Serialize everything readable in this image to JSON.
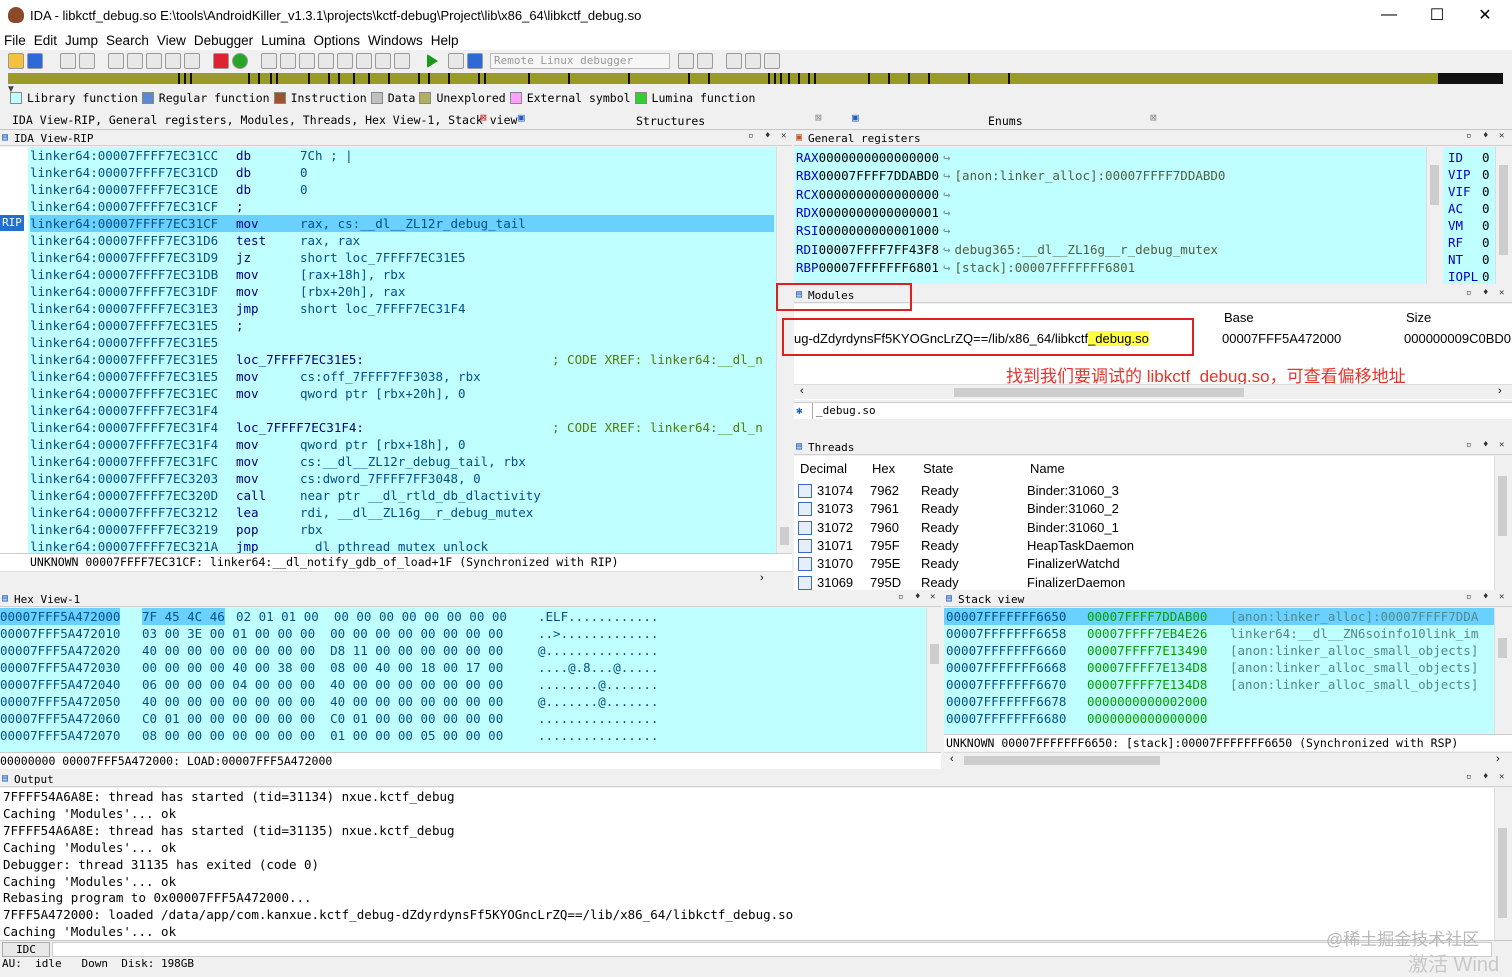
{
  "window": {
    "title": "IDA - libkctf_debug.so E:\\tools\\AndroidKiller_v1.3.1\\projects\\kctf-debug\\Project\\lib\\x86_64\\libkctf_debug.so",
    "minimize": "—",
    "maximize": "☐",
    "close": "✕"
  },
  "menu": [
    "File",
    "Edit",
    "Jump",
    "Search",
    "View",
    "Debugger",
    "Lumina",
    "Options",
    "Windows",
    "Help"
  ],
  "toolbar": {
    "debugger_select": "Remote Linux debugger"
  },
  "legend": [
    {
      "label": "Library function",
      "color": "#c0ffff"
    },
    {
      "label": "Regular function",
      "color": "#5a8ad0"
    },
    {
      "label": "Instruction",
      "color": "#a0522d"
    },
    {
      "label": "Data",
      "color": "#c0c0c0"
    },
    {
      "label": "Unexplored",
      "color": "#b0b060"
    },
    {
      "label": "External symbol",
      "color": "#ffa0ff"
    },
    {
      "label": "Lumina function",
      "color": "#30d030"
    }
  ],
  "tabs": {
    "left": "IDA View-RIP, General registers, Modules, Threads, Hex View-1, Stack view",
    "structures": "Structures",
    "enums": "Enums"
  },
  "ida_view": {
    "title": "IDA View-RIP",
    "rip_label": "RIP",
    "lines": [
      {
        "addr": "linker64:00007FFFF7EC31CC",
        "mn": "db",
        "op": "7Ch ; |",
        "cm": ""
      },
      {
        "addr": "linker64:00007FFFF7EC31CD",
        "mn": "db",
        "op": "0",
        "cm": ""
      },
      {
        "addr": "linker64:00007FFFF7EC31CE",
        "mn": "db",
        "op": "0",
        "cm": ""
      },
      {
        "addr": "linker64:00007FFFF7EC31CF",
        "mn": ";",
        "op": "",
        "cm": ""
      },
      {
        "addr": "linker64:00007FFFF7EC31CF",
        "mn": "mov",
        "op": "rax, cs:__dl__ZL12r_debug_tail",
        "cm": ""
      },
      {
        "addr": "linker64:00007FFFF7EC31D6",
        "mn": "test",
        "op": "rax, rax",
        "cm": ""
      },
      {
        "addr": "linker64:00007FFFF7EC31D9",
        "mn": "jz",
        "op": "short loc_7FFFF7EC31E5",
        "cm": ""
      },
      {
        "addr": "linker64:00007FFFF7EC31DB",
        "mn": "mov",
        "op": "[rax+18h], rbx",
        "cm": ""
      },
      {
        "addr": "linker64:00007FFFF7EC31DF",
        "mn": "mov",
        "op": "[rbx+20h], rax",
        "cm": ""
      },
      {
        "addr": "linker64:00007FFFF7EC31E3",
        "mn": "jmp",
        "op": "short loc_7FFFF7EC31F4",
        "cm": ""
      },
      {
        "addr": "linker64:00007FFFF7EC31E5",
        "mn": ";",
        "op": "",
        "cm": ""
      },
      {
        "addr": "linker64:00007FFFF7EC31E5",
        "mn": "",
        "op": "",
        "cm": ""
      },
      {
        "addr": "linker64:00007FFFF7EC31E5",
        "mn": "loc_7FFFF7EC31E5:",
        "op": "",
        "cm": "; CODE XREF: linker64:__dl_n"
      },
      {
        "addr": "linker64:00007FFFF7EC31E5",
        "mn": "mov",
        "op": "cs:off_7FFFF7FF3038, rbx",
        "cm": ""
      },
      {
        "addr": "linker64:00007FFFF7EC31EC",
        "mn": "mov",
        "op": "qword ptr [rbx+20h], 0",
        "cm": ""
      },
      {
        "addr": "linker64:00007FFFF7EC31F4",
        "mn": "",
        "op": "",
        "cm": ""
      },
      {
        "addr": "linker64:00007FFFF7EC31F4",
        "mn": "loc_7FFFF7EC31F4:",
        "op": "",
        "cm": "; CODE XREF: linker64:__dl_n"
      },
      {
        "addr": "linker64:00007FFFF7EC31F4",
        "mn": "mov",
        "op": "qword ptr [rbx+18h], 0",
        "cm": ""
      },
      {
        "addr": "linker64:00007FFFF7EC31FC",
        "mn": "mov",
        "op": "cs:__dl__ZL12r_debug_tail, rbx",
        "cm": ""
      },
      {
        "addr": "linker64:00007FFFF7EC3203",
        "mn": "mov",
        "op": "cs:dword_7FFFF7FF3048, 0",
        "cm": ""
      },
      {
        "addr": "linker64:00007FFFF7EC320D",
        "mn": "call",
        "op": "near ptr __dl_rtld_db_dlactivity",
        "cm": ""
      },
      {
        "addr": "linker64:00007FFFF7EC3212",
        "mn": "lea",
        "op": "rdi, __dl__ZL16g__r_debug_mutex",
        "cm": ""
      },
      {
        "addr": "linker64:00007FFFF7EC3219",
        "mn": "pop",
        "op": "rbx",
        "cm": ""
      },
      {
        "addr": "linker64:00007FFFF7EC321A",
        "mn": "jmp",
        "op": "__dl_pthread_mutex_unlock",
        "cm": ""
      }
    ],
    "status": "UNKNOWN 00007FFFF7EC31CF: linker64:__dl_notify_gdb_of_load+1F (Synchronized with RIP)"
  },
  "general_registers": {
    "title": "General registers",
    "regs": [
      {
        "name": "RAX",
        "value": "0000000000000000",
        "target": ""
      },
      {
        "name": "RBX",
        "value": "00007FFFF7DDABD0",
        "target": "[anon:linker_alloc]:00007FFFF7DDABD0"
      },
      {
        "name": "RCX",
        "value": "0000000000000000",
        "target": ""
      },
      {
        "name": "RDX",
        "value": "0000000000000001",
        "target": ""
      },
      {
        "name": "RSI",
        "value": "0000000000001000",
        "target": ""
      },
      {
        "name": "RDI",
        "value": "00007FFFF7FF43F8",
        "target": "debug365:__dl__ZL16g__r_debug_mutex"
      },
      {
        "name": "RBP",
        "value": "00007FFFFFFF6801",
        "target": "[stack]:00007FFFFFFF6801"
      }
    ],
    "flags": [
      {
        "name": "ID",
        "value": "0"
      },
      {
        "name": "VIP",
        "value": "0"
      },
      {
        "name": "VIF",
        "value": "0"
      },
      {
        "name": "AC",
        "value": "0"
      },
      {
        "name": "VM",
        "value": "0"
      },
      {
        "name": "RF",
        "value": "0"
      },
      {
        "name": "NT",
        "value": "0"
      },
      {
        "name": "IOPL",
        "value": "0"
      }
    ]
  },
  "modules": {
    "title": "Modules",
    "col_base": "Base",
    "col_size": "Size",
    "row_path_a": "ug-dZdyrdynsFf5KYOGncLrZQ==/lib/x86_64/libkctf",
    "row_path_b": "_debug.so",
    "row_base": "00007FFF5A472000",
    "row_size": "000000009C0BD0",
    "annotation": "找到我们要调试的 libkctf_debug.so，可查看偏移地址",
    "filter": "_debug.so"
  },
  "threads": {
    "title": "Threads",
    "columns": [
      "Decimal",
      "Hex",
      "State",
      "Name"
    ],
    "rows": [
      {
        "dec": "31074",
        "hex": "7962",
        "state": "Ready",
        "name": "Binder:31060_3"
      },
      {
        "dec": "31073",
        "hex": "7961",
        "state": "Ready",
        "name": "Binder:31060_2"
      },
      {
        "dec": "31072",
        "hex": "7960",
        "state": "Ready",
        "name": "Binder:31060_1"
      },
      {
        "dec": "31071",
        "hex": "795F",
        "state": "Ready",
        "name": "HeapTaskDaemon"
      },
      {
        "dec": "31070",
        "hex": "795E",
        "state": "Ready",
        "name": "FinalizerWatchd"
      },
      {
        "dec": "31069",
        "hex": "795D",
        "state": "Ready",
        "name": "FinalizerDaemon"
      }
    ]
  },
  "hex_view": {
    "title": "Hex View-1",
    "rows": [
      {
        "addr": "00007FFF5A472000",
        "sel": "7F 45 4C 46",
        "bytes": "02 01 01 00  00 00 00 00 00 00 00 00",
        "ascii": ".ELF............"
      },
      {
        "addr": "00007FFF5A472010",
        "sel": "",
        "bytes": "03 00 3E 00 01 00 00 00  00 00 00 00 00 00 00 00",
        "ascii": "..>............."
      },
      {
        "addr": "00007FFF5A472020",
        "sel": "",
        "bytes": "40 00 00 00 00 00 00 00  D8 11 00 00 00 00 00 00",
        "ascii": "@..............."
      },
      {
        "addr": "00007FFF5A472030",
        "sel": "",
        "bytes": "00 00 00 00 40 00 38 00  08 00 40 00 18 00 17 00",
        "ascii": "....@.8...@....."
      },
      {
        "addr": "00007FFF5A472040",
        "sel": "",
        "bytes": "06 00 00 00 04 00 00 00  40 00 00 00 00 00 00 00",
        "ascii": "........@......."
      },
      {
        "addr": "00007FFF5A472050",
        "sel": "",
        "bytes": "40 00 00 00 00 00 00 00  40 00 00 00 00 00 00 00",
        "ascii": "@.......@......."
      },
      {
        "addr": "00007FFF5A472060",
        "sel": "",
        "bytes": "C0 01 00 00 00 00 00 00  C0 01 00 00 00 00 00 00",
        "ascii": "................"
      },
      {
        "addr": "00007FFF5A472070",
        "sel": "",
        "bytes": "08 00 00 00 00 00 00 00  01 00 00 00 05 00 00 00",
        "ascii": "................"
      }
    ],
    "status": "00000000 00007FFF5A472000: LOAD:00007FFF5A472000"
  },
  "stack_view": {
    "title": "Stack view",
    "rows": [
      {
        "addr": "00007FFFFFFF6650",
        "val": "00007FFFF7DDAB00",
        "tag": "[anon:linker_alloc]:00007FFFF7DDA"
      },
      {
        "addr": "00007FFFFFFF6658",
        "val": "00007FFFF7EB4E26",
        "tag": "linker64:__dl__ZN6soinfo10link_im"
      },
      {
        "addr": "00007FFFFFFF6660",
        "val": "00007FFFF7E13490",
        "tag": "[anon:linker_alloc_small_objects]"
      },
      {
        "addr": "00007FFFFFFF6668",
        "val": "00007FFFF7E134D8",
        "tag": "[anon:linker_alloc_small_objects]"
      },
      {
        "addr": "00007FFFFFFF6670",
        "val": "00007FFFF7E134D8",
        "tag": "[anon:linker_alloc_small_objects]"
      },
      {
        "addr": "00007FFFFFFF6678",
        "val": "0000000000002000",
        "tag": ""
      },
      {
        "addr": "00007FFFFFFF6680",
        "val": "0000000000000000",
        "tag": ""
      }
    ],
    "status": "UNKNOWN 00007FFFFFFF6650: [stack]:00007FFFFFFF6650 (Synchronized with RSP)"
  },
  "output": {
    "title": "Output",
    "lines": [
      "7FFFF54A6A8E: thread has started (tid=31134) nxue.kctf_debug",
      "Caching 'Modules'... ok",
      "7FFFF54A6A8E: thread has started (tid=31135) nxue.kctf_debug",
      "Caching 'Modules'... ok",
      "Debugger: thread 31135 has exited (code 0)",
      "Caching 'Modules'... ok",
      "Rebasing program to 0x00007FFF5A472000...",
      "7FFF5A472000: loaded /data/app/com.kanxue.kctf_debug-dZdyrdynsFf5KYOGncLrZQ==/lib/x86_64/libkctf_debug.so",
      "Caching 'Modules'... ok"
    ]
  },
  "idc": {
    "label": "IDC"
  },
  "statusbar": "AU:  idle   Down  Disk: 198GB",
  "watermark": {
    "line1": "@稀土掘金技术社区",
    "line2": "激活 Wind"
  }
}
